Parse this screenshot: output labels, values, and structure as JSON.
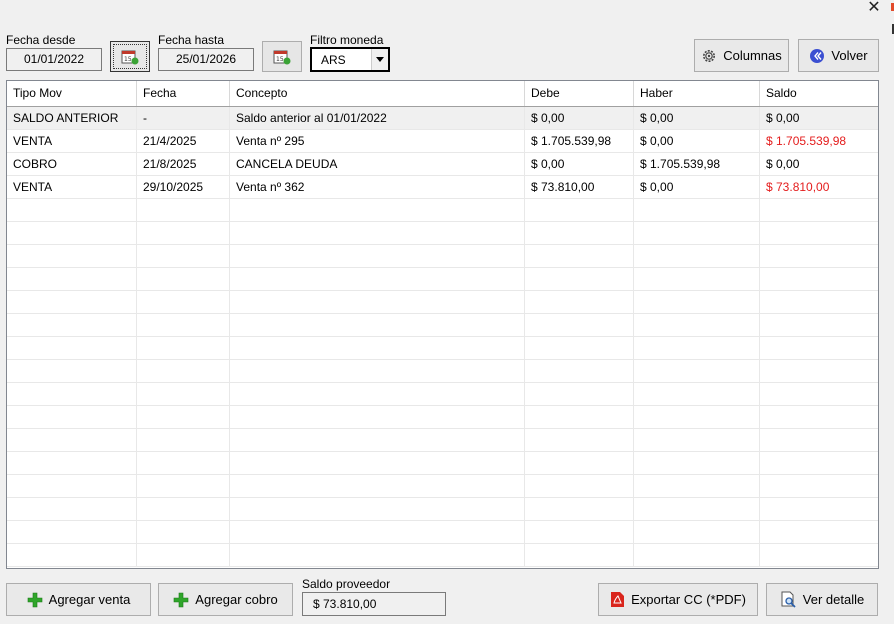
{
  "window": {
    "close_glyph": "✕"
  },
  "filters": {
    "fecha_desde_label": "Fecha desde",
    "fecha_desde_value": "01/01/2022",
    "fecha_hasta_label": "Fecha hasta",
    "fecha_hasta_value": "25/01/2026",
    "moneda_label": "Filtro moneda",
    "moneda_value": "ARS"
  },
  "toolbar": {
    "columnas_label": "Columnas",
    "volver_label": "Volver"
  },
  "table": {
    "columns": [
      "Tipo Mov",
      "Fecha",
      "Concepto",
      "Debe",
      "Haber",
      "Saldo"
    ],
    "rows": [
      {
        "tipo": "SALDO ANTERIOR",
        "fecha": "-",
        "concepto": "Saldo anterior al 01/01/2022",
        "debe": "$ 0,00",
        "haber": "$ 0,00",
        "saldo": "$ 0,00",
        "saldo_negative": false
      },
      {
        "tipo": "VENTA",
        "fecha": "21/4/2025",
        "concepto": "Venta nº 295",
        "debe": "$ 1.705.539,98",
        "haber": "$ 0,00",
        "saldo": "$ 1.705.539,98",
        "saldo_negative": true
      },
      {
        "tipo": "COBRO",
        "fecha": "21/8/2025",
        "concepto": "CANCELA DEUDA",
        "debe": "$ 0,00",
        "haber": "$ 1.705.539,98",
        "saldo": "$ 0,00",
        "saldo_negative": false
      },
      {
        "tipo": "VENTA",
        "fecha": "29/10/2025",
        "concepto": "Venta nº 362",
        "debe": "$ 73.810,00",
        "haber": "$ 0,00",
        "saldo": "$ 73.810,00",
        "saldo_negative": true
      }
    ]
  },
  "footer": {
    "agregar_venta_label": "Agregar venta",
    "agregar_cobro_label": "Agregar cobro",
    "saldo_proveedor_label": "Saldo proveedor",
    "saldo_proveedor_value": "$ 73.810,00",
    "exportar_label": "Exportar CC (*PDF)",
    "ver_detalle_label": "Ver detalle"
  },
  "colors": {
    "negative": "#e41c1c",
    "plus_icon": "#2fa52a",
    "volver_icon": "#3b4fd1",
    "pdf_icon": "#d9251c"
  }
}
